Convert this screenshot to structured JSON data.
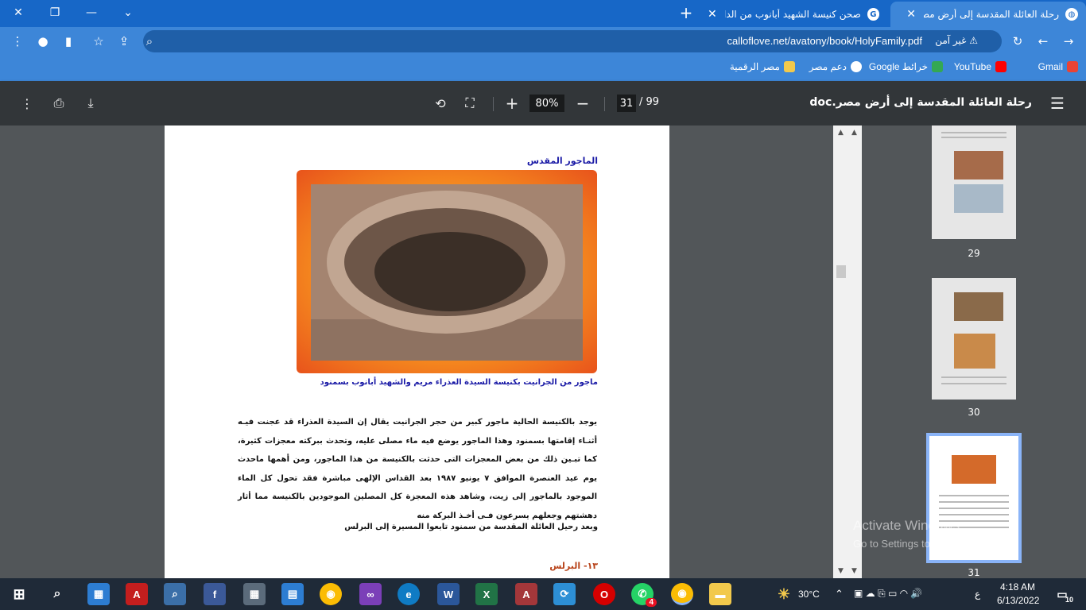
{
  "browser": {
    "tabs": [
      {
        "title": "رحلة العائلة المقدسة إلى أرض مصر",
        "active": true
      },
      {
        "title": "صحن كنيسة الشهيد أبانوب من الداخ",
        "active": false
      }
    ],
    "new_tab": "+",
    "address": "calloflove.net/avatony/book/HolyFamily.pdf",
    "security_label": "غير آمن",
    "bookmarks": [
      {
        "label": "Gmail",
        "icon": "gmail-icon",
        "color": "#ea4335"
      },
      {
        "label": "YouTube",
        "icon": "youtube-icon",
        "color": "#ff0000"
      },
      {
        "label": "خرائط Google",
        "icon": "maps-icon",
        "color": "#34a853"
      },
      {
        "label": "دعم مصر",
        "icon": "globe-icon",
        "color": "#ffffff"
      },
      {
        "label": "مصر الرقمية",
        "icon": "site-icon",
        "color": "#f2c94c"
      }
    ]
  },
  "pdf": {
    "title": "رحلة العائلة المقدسة إلى أرض مصر.doc",
    "zoom": "80%",
    "page_current": "31",
    "page_total": "/ 99"
  },
  "page": {
    "heading": "الماجور المقدس",
    "caption": "ماجور من الجرانيت بكنيسة السيدة العذراء مريم والشهيد أبانوب بسمنود",
    "body": "يوجد بالكنيسة الحالية ماجور كبير من حجر الجرانيت يقال إن السيدة العذراء قد عجنت فيـه أثنـاء إقامتها بسمنود وهذا الماجور يوضع فيه ماء مصلى عليه، وتحدث ببركته معجزات كثيرة، كما تبـين ذلك من بعض المعجزات التى حدثت بالكنيسة من هذا الماجور، ومن أهمها ماحدث يوم عيد العنصرة الموافق ٧ يونيو ١٩٨٧ بعد القداس الإلهى مباشرة فقد تحول كل الماء الموجود بالماجور إلى زيت، وشاهد هذه المعجزة كل المصلين الموجودين بالكنيسة مما أثار دهشتهم وجعلهم يسرعون فـى أخـذ البركة منه",
    "after": "وبعد رحيل العائلة المقدسة من سمنود تابعوا المسيرة إلى البرلس",
    "section": "١٣- البرلس"
  },
  "thumbnails": [
    {
      "number": "29"
    },
    {
      "number": "30"
    },
    {
      "number": "31",
      "selected": true
    }
  ],
  "watermark": {
    "line1": "Activate Windows",
    "line2": "Go to Settings to activate Windows."
  },
  "taskbar": {
    "temperature": "30°C",
    "time": "4:18 AM",
    "date": "6/13/2022",
    "lang": "ع",
    "notifications": "10",
    "whatsapp_badge": "4"
  }
}
